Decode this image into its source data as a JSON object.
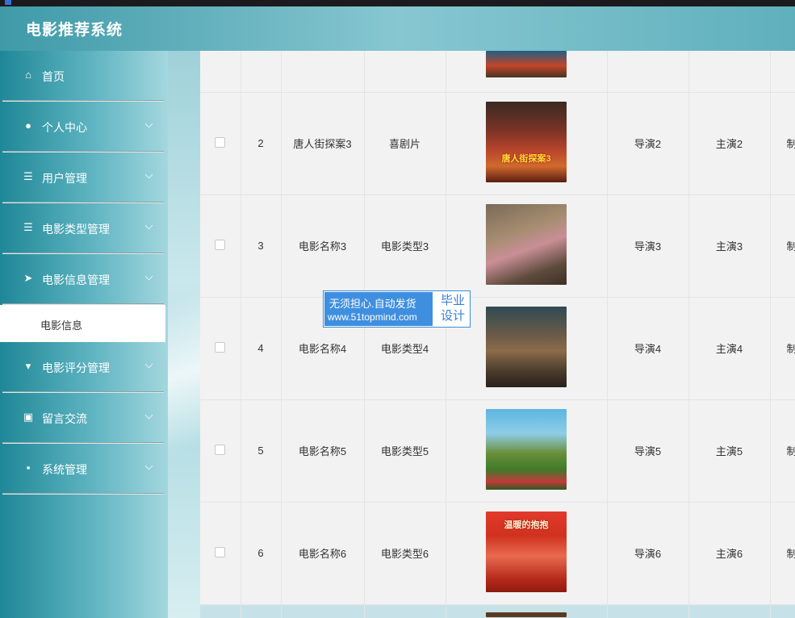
{
  "app": {
    "title": "电影推荐系统"
  },
  "sidebar": {
    "items": [
      {
        "label": "首页",
        "icon": "home-icon",
        "glyph": "⌂"
      },
      {
        "label": "个人中心",
        "icon": "user-icon",
        "glyph": "●"
      },
      {
        "label": "用户管理",
        "icon": "list-icon",
        "glyph": "☰"
      },
      {
        "label": "电影类型管理",
        "icon": "list-indent-icon",
        "glyph": "☰"
      },
      {
        "label": "电影信息管理",
        "icon": "send-icon",
        "glyph": "➤"
      },
      {
        "label": "电影评分管理",
        "icon": "flag-icon",
        "glyph": "▾"
      },
      {
        "label": "留言交流",
        "icon": "clipboard-icon",
        "glyph": "▣"
      },
      {
        "label": "系统管理",
        "icon": "comment-icon",
        "glyph": "▪"
      }
    ],
    "active_submenu": "电影信息"
  },
  "table": {
    "rows": [
      {
        "index": "2",
        "name": "唐人街探案3",
        "type": "喜剧片",
        "director": "导演2",
        "actor": "主演2",
        "extra": "制",
        "poster_title": "唐人街探案3"
      },
      {
        "index": "3",
        "name": "电影名称3",
        "type": "电影类型3",
        "director": "导演3",
        "actor": "主演3",
        "extra": "制",
        "poster_title": ""
      },
      {
        "index": "4",
        "name": "电影名称4",
        "type": "电影类型4",
        "director": "导演4",
        "actor": "主演4",
        "extra": "制",
        "poster_title": ""
      },
      {
        "index": "5",
        "name": "电影名称5",
        "type": "电影类型5",
        "director": "导演5",
        "actor": "主演5",
        "extra": "制",
        "poster_title": ""
      },
      {
        "index": "6",
        "name": "电影名称6",
        "type": "电影类型6",
        "director": "导演6",
        "actor": "主演6",
        "extra": "制",
        "poster_title": "温暖的抱抱"
      }
    ]
  },
  "watermark": {
    "line1": "无须担心.自动发货",
    "line2": "www.51topmind.com",
    "right1": "毕业",
    "right2": "设计"
  },
  "colors": {
    "header": "#5fb0bd",
    "sidebar": "#1f8797",
    "table_bg": "#f2f2f2",
    "watermark": "#3f8fe0"
  }
}
